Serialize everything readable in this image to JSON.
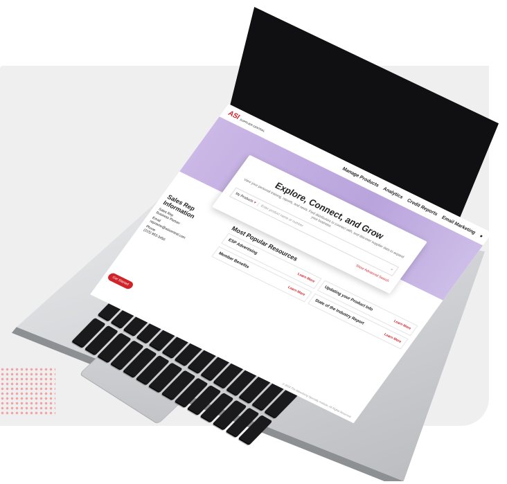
{
  "brand": {
    "logo_text": "ASI",
    "logo_sub": "SUPPLIER CENTRAL"
  },
  "nav": [
    "Manage Products",
    "Analytics",
    "Credit Reports",
    "Email Marketing"
  ],
  "hero": {
    "title": "Explore, Connect, and Grow",
    "subtitle": "View your personal training, reports, and news. Find distributors to connect with, and discover supplier data to expand your business."
  },
  "search": {
    "select_value": "My Products",
    "placeholder": "Enter product name or number",
    "advanced_label": "Show Advanced Search"
  },
  "sales_rep": {
    "heading": "Sales Rep Information",
    "name": "Sales Rep",
    "role": "Business Partner",
    "email_label": "Email",
    "email": "repname@asicentral.com",
    "phone_label": "Phone",
    "phone": "(215) 953-3450"
  },
  "resources": {
    "heading": "Most Popular Resources",
    "learn_label": "Learn More",
    "items": [
      "ESP Advertising",
      "Updating your Product Info",
      "Member Benefits",
      "State of the Industry Report"
    ]
  },
  "fab_label": "Get Started",
  "footer_text": "© 2024 The Advertising Specialty Institute. All Rights Reserved."
}
